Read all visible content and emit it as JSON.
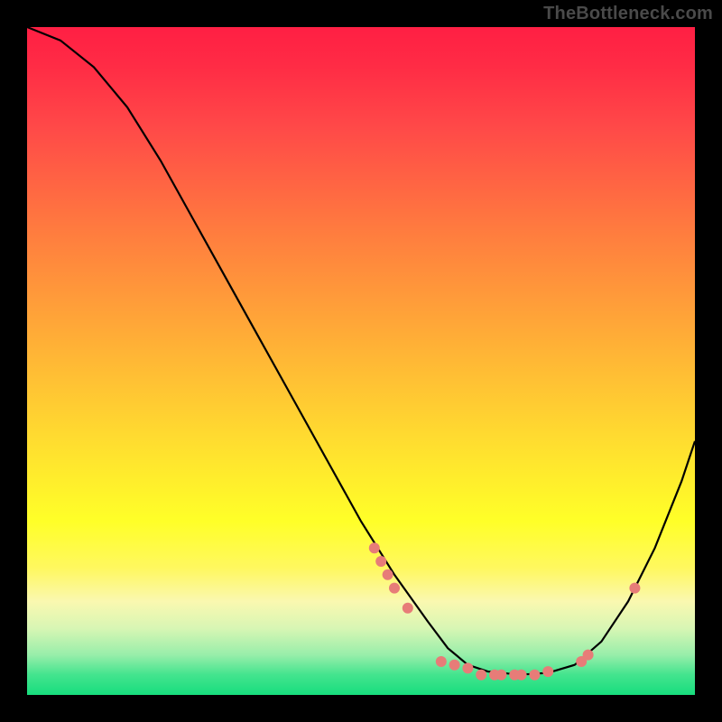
{
  "watermark": "TheBottleneck.com",
  "chart_data": {
    "type": "line",
    "title": "",
    "xlabel": "",
    "ylabel": "",
    "xlim": [
      0,
      100
    ],
    "ylim": [
      0,
      100
    ],
    "curve": {
      "x": [
        0,
        5,
        10,
        15,
        20,
        25,
        30,
        35,
        40,
        45,
        50,
        55,
        60,
        63,
        66,
        69,
        72,
        75,
        78,
        82,
        86,
        90,
        94,
        98,
        100
      ],
      "values": [
        100,
        98,
        94,
        88,
        80,
        71,
        62,
        53,
        44,
        35,
        26,
        18,
        11,
        7,
        4.5,
        3.5,
        3.2,
        3.1,
        3.3,
        4.5,
        8,
        14,
        22,
        32,
        38
      ]
    },
    "points": {
      "x": [
        52,
        53,
        54,
        55,
        57,
        62,
        64,
        66,
        68,
        70,
        71,
        73,
        74,
        76,
        78,
        83,
        84,
        91
      ],
      "values": [
        22,
        20,
        18,
        16,
        13,
        5,
        4.5,
        4,
        3,
        3,
        3,
        3,
        3,
        3,
        3.5,
        5,
        6,
        16
      ]
    },
    "point_color": "#e77c78",
    "curve_color": "#000000"
  }
}
